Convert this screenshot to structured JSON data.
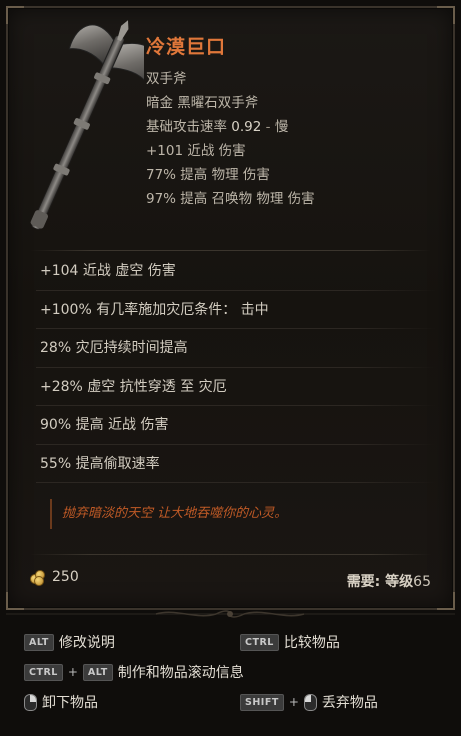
{
  "item": {
    "name": "冷漠巨口",
    "type": "双手斧",
    "subtype": "暗金 黑曜石双手斧",
    "attack_speed_label": "基础攻击速率 ",
    "attack_speed_value": "0.92",
    "attack_speed_sep": " - ",
    "attack_speed_desc": "慢",
    "implicits": [
      "+101 近战 伤害",
      "77% 提高 物理 伤害",
      "97% 提高 召唤物 物理 伤害"
    ],
    "affixes": [
      "+104 近战 虚空 伤害",
      "+100% 有几率施加灾厄条件： 击中",
      "28% 灾厄持续时间提高",
      "+28% 虚空 抗性穿透 至 灾厄",
      "90% 提高 近战 伤害",
      "55% 提高偷取速率"
    ],
    "flavor": "抛弃暗淡的天空 让大地吞噬你的心灵。",
    "gold_value": "250",
    "requirement_label": "需要: 等级",
    "requirement_level": "65"
  },
  "controls": {
    "alt_key": "ALT",
    "alt_label": "修改说明",
    "ctrl_key": "CTRL",
    "ctrl_label": "比较物品",
    "ctrl_alt_label": "制作和物品滚动信息",
    "unequip_label": "卸下物品",
    "shift_key": "SHIFT",
    "drop_label": "丢弃物品"
  },
  "colors": {
    "name": "#e0773a",
    "flavor": "#c05a26",
    "text": "#d2ccc0"
  },
  "icons": [
    "axe-weapon-icon",
    "gold-coin-icon",
    "mouse-left-icon",
    "mouse-right-icon"
  ]
}
